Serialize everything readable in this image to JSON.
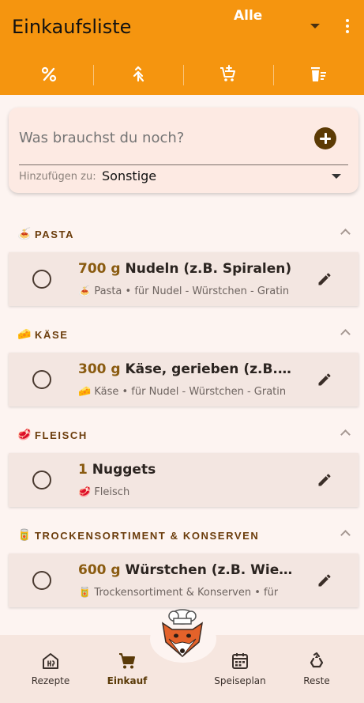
{
  "app": {
    "title": "Einkaufsliste",
    "filter_value": "Alle"
  },
  "toolbar": {
    "tools": [
      {
        "name": "percent-icon"
      },
      {
        "name": "merge-icon"
      },
      {
        "name": "cart-add-icon"
      },
      {
        "name": "clear-list-icon"
      }
    ]
  },
  "add_card": {
    "placeholder": "Was brauchst du noch?",
    "add_to_label": "Hinzufügen zu:",
    "add_to_value": "Sonstige"
  },
  "sections": [
    {
      "name": "PASTA",
      "icon": "🍝",
      "items": [
        {
          "qty": "700 g",
          "name": "Nudeln (z.B. Spiralen)",
          "detail_icon": "🍝",
          "detail": "Pasta • für Nudel - Würstchen - Gratin"
        }
      ]
    },
    {
      "name": "KÄSE",
      "icon": "🧀",
      "items": [
        {
          "qty": "300 g",
          "name": "Käse, gerieben (z.B. Parmesan)",
          "detail_icon": "🧀",
          "detail": "Käse • für Nudel - Würstchen - Gratin"
        }
      ]
    },
    {
      "name": "FLEISCH",
      "icon": "🥩",
      "items": [
        {
          "qty": "1",
          "name": "Nuggets",
          "detail_icon": "🥩",
          "detail": "Fleisch"
        }
      ]
    },
    {
      "name": "TROCKENSORTIMENT & KONSERVEN",
      "icon": "🥫",
      "items": [
        {
          "qty": "600 g",
          "name": "Würstchen (z.B. Wiener)",
          "detail_icon": "🥫",
          "detail": "Trockensortiment & Konserven • für"
        }
      ]
    }
  ],
  "bottom_nav": {
    "items": [
      {
        "label": "Rezepte",
        "icon": "recipe-book-icon"
      },
      {
        "label": "Einkauf",
        "icon": "cart-icon",
        "active": true
      },
      {
        "label": "Speiseplan",
        "icon": "calendar-icon"
      },
      {
        "label": "Reste",
        "icon": "recycle-icon"
      }
    ]
  },
  "colors": {
    "appbar": "#f5950f",
    "accent_brown": "#6b3c0b",
    "background": "#fdf4f1"
  }
}
